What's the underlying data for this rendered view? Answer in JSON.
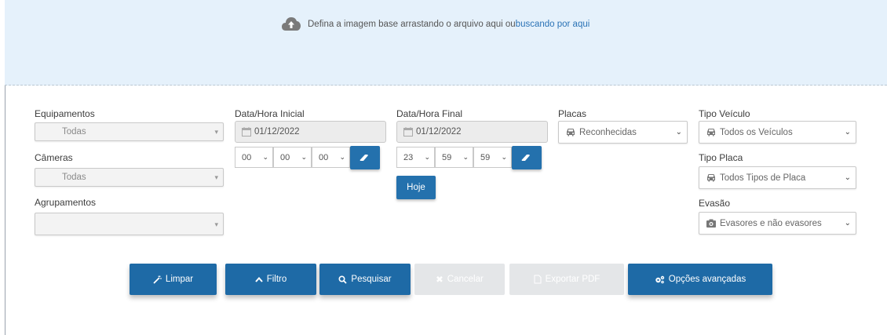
{
  "upload": {
    "message": "Defina a imagem base arrastando o arquivo aqui ou",
    "link": "buscando por aqui",
    "icon": "cloud-upload-icon"
  },
  "filters": {
    "equipamentos": {
      "label": "Equipamentos",
      "value": "Todas"
    },
    "cameras": {
      "label": "Câmeras",
      "value": "Todas"
    },
    "agrupamentos": {
      "label": "Agrupamentos",
      "value": ""
    },
    "inicio": {
      "label": "Data/Hora Inicial",
      "date": "01/12/2022",
      "hour": "00",
      "minute": "00",
      "second": "00"
    },
    "fim": {
      "label": "Data/Hora Final",
      "date": "01/12/2022",
      "hour": "23",
      "minute": "59",
      "second": "59",
      "today_label": "Hoje"
    },
    "placas": {
      "label": "Placas",
      "value": "Reconhecidas"
    },
    "tipo_veiculo": {
      "label": "Tipo Veículo",
      "value": "Todos os Veículos"
    },
    "tipo_placa": {
      "label": "Tipo Placa",
      "value": "Todos Tipos de Placa"
    },
    "evasao": {
      "label": "Evasão",
      "value": "Evasores e não evasores"
    }
  },
  "actions": {
    "limpar": "Limpar",
    "filtro": "Filtro",
    "pesquisar": "Pesquisar",
    "cancelar": "Cancelar",
    "exportar": "Exportar PDF",
    "opcoes": "Opções avançadas"
  },
  "colors": {
    "primary": "#1e6aa6",
    "banner": "#e5f1fb",
    "disabled": "#e4e6e8"
  }
}
